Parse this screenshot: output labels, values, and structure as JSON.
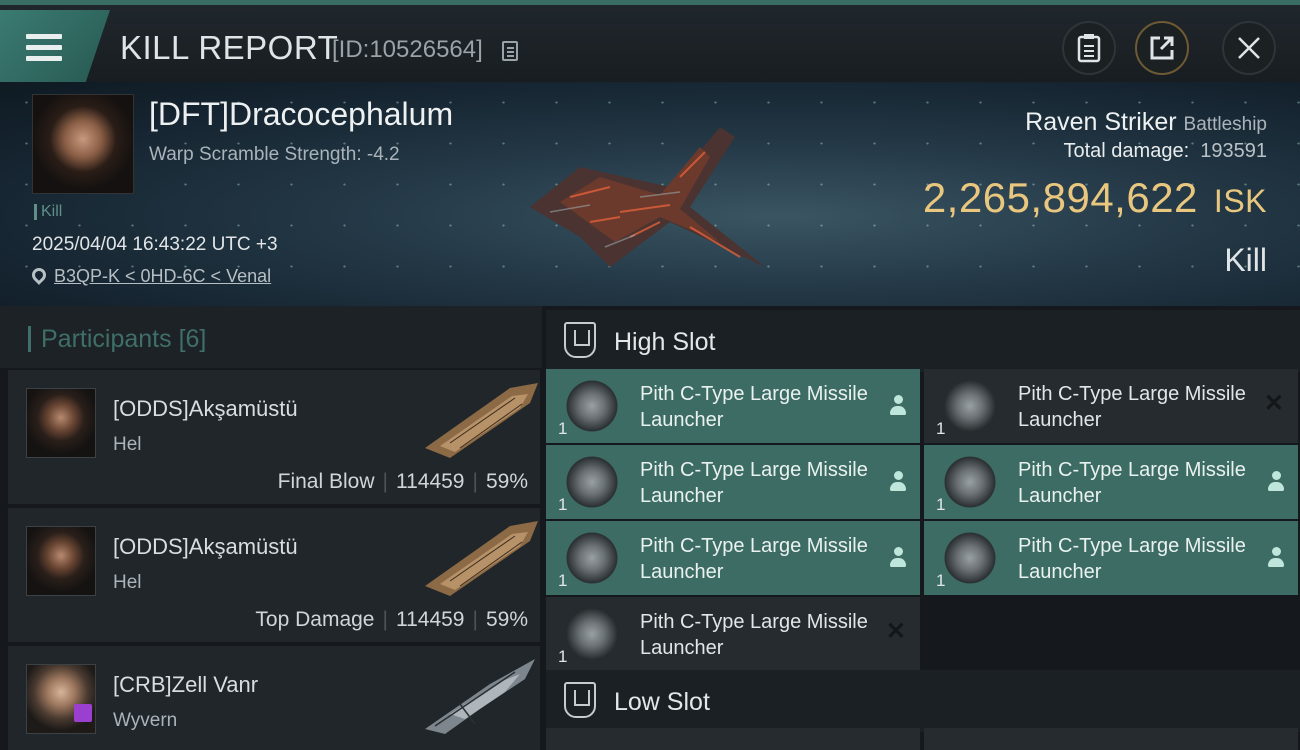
{
  "header": {
    "title": "KILL REPORT",
    "report_id": "[ID:10526564]",
    "icons": {
      "menu": "menu-icon",
      "copy": "copy-icon",
      "clipboard": "clipboard-icon",
      "share": "share-icon",
      "close": "close-icon"
    }
  },
  "victim": {
    "name": "[DFT]Dracocephalum",
    "warp_scramble": "Warp Scramble Strength: -4.2",
    "kill_tag": "Kill",
    "datetime": "2025/04/04 16:43:22 UTC +3",
    "location": "B3QP-K < 0HD-6C < Venal",
    "ship_name": "Raven Striker",
    "ship_class": "Battleship",
    "total_damage_label": "Total damage:",
    "total_damage": "193591",
    "isk_value": "2,265,894,622",
    "isk_unit": "ISK",
    "result": "Kill"
  },
  "participants": {
    "title": "Participants",
    "count": "[6]",
    "list": [
      {
        "name": "[ODDS]Akşamüstü",
        "ship": "Hel",
        "role": "Final Blow",
        "damage": "114459",
        "percent": "59%"
      },
      {
        "name": "[ODDS]Akşamüstü",
        "ship": "Hel",
        "role": "Top Damage",
        "damage": "114459",
        "percent": "59%"
      },
      {
        "name": "[CRB]Zell Vanr",
        "ship": "Wyvern"
      }
    ]
  },
  "slots": {
    "high": {
      "title": "High Slot",
      "modules": [
        {
          "qty": "1",
          "name": "Pith C-Type Large Missile Launcher",
          "state": "fitted"
        },
        {
          "qty": "1",
          "name": "Pith C-Type Large Missile Launcher",
          "state": "destroyed"
        },
        {
          "qty": "1",
          "name": "Pith C-Type Large Missile Launcher",
          "state": "fitted"
        },
        {
          "qty": "1",
          "name": "Pith C-Type Large Missile Launcher",
          "state": "fitted"
        },
        {
          "qty": "1",
          "name": "Pith C-Type Large Missile Launcher",
          "state": "fitted"
        },
        {
          "qty": "1",
          "name": "Pith C-Type Large Missile Launcher",
          "state": "fitted"
        },
        {
          "qty": "1",
          "name": "Pith C-Type Large Missile Launcher",
          "state": "destroyed"
        }
      ]
    },
    "low": {
      "title": "Low Slot"
    }
  },
  "colors": {
    "accent": "#3d6c65",
    "isk": "#e9c77e",
    "background": "#15191d"
  }
}
